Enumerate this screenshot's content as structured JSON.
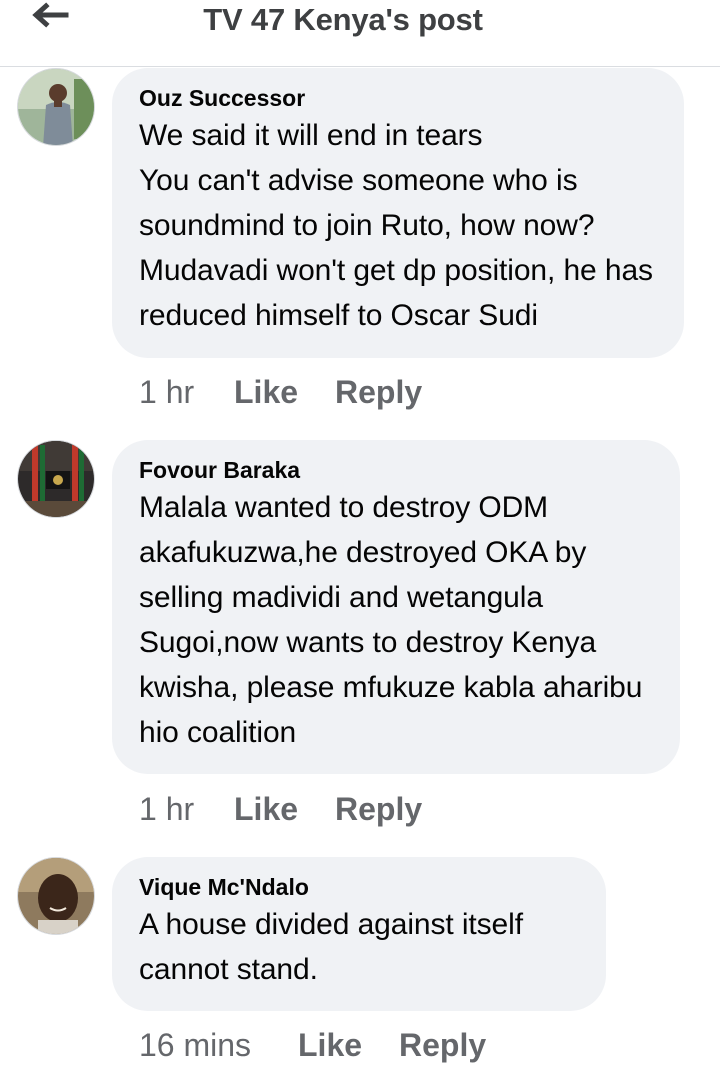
{
  "header": {
    "title": "TV 47 Kenya's post",
    "back_icon": "arrow-left-icon"
  },
  "comments": [
    {
      "author": "Ouz Successor",
      "text": "We said it will end in tears\nYou can't advise someone who is soundmind to join Ruto, how now?\nMudavadi won't get dp position, he has reduced himself to Oscar Sudi",
      "time": "1 hr",
      "like_label": "Like",
      "reply_label": "Reply"
    },
    {
      "author": "Fovour Baraka",
      "text": "Malala wanted to destroy ODM akafukuzwa,he destroyed OKA by selling madividi and wetangula Sugoi,now wants to destroy Kenya kwisha, please mfukuze kabla aharibu hio coalition",
      "time": "1 hr",
      "like_label": "Like",
      "reply_label": "Reply"
    },
    {
      "author": "Vique Mc'Ndalo",
      "text": "A house divided against itself cannot stand.",
      "time": "16 mins",
      "like_label": "Like",
      "reply_label": "Reply"
    }
  ],
  "colors": {
    "bubble": "#f0f2f5",
    "meta_text": "#65676b",
    "header_text": "#3e4042"
  }
}
